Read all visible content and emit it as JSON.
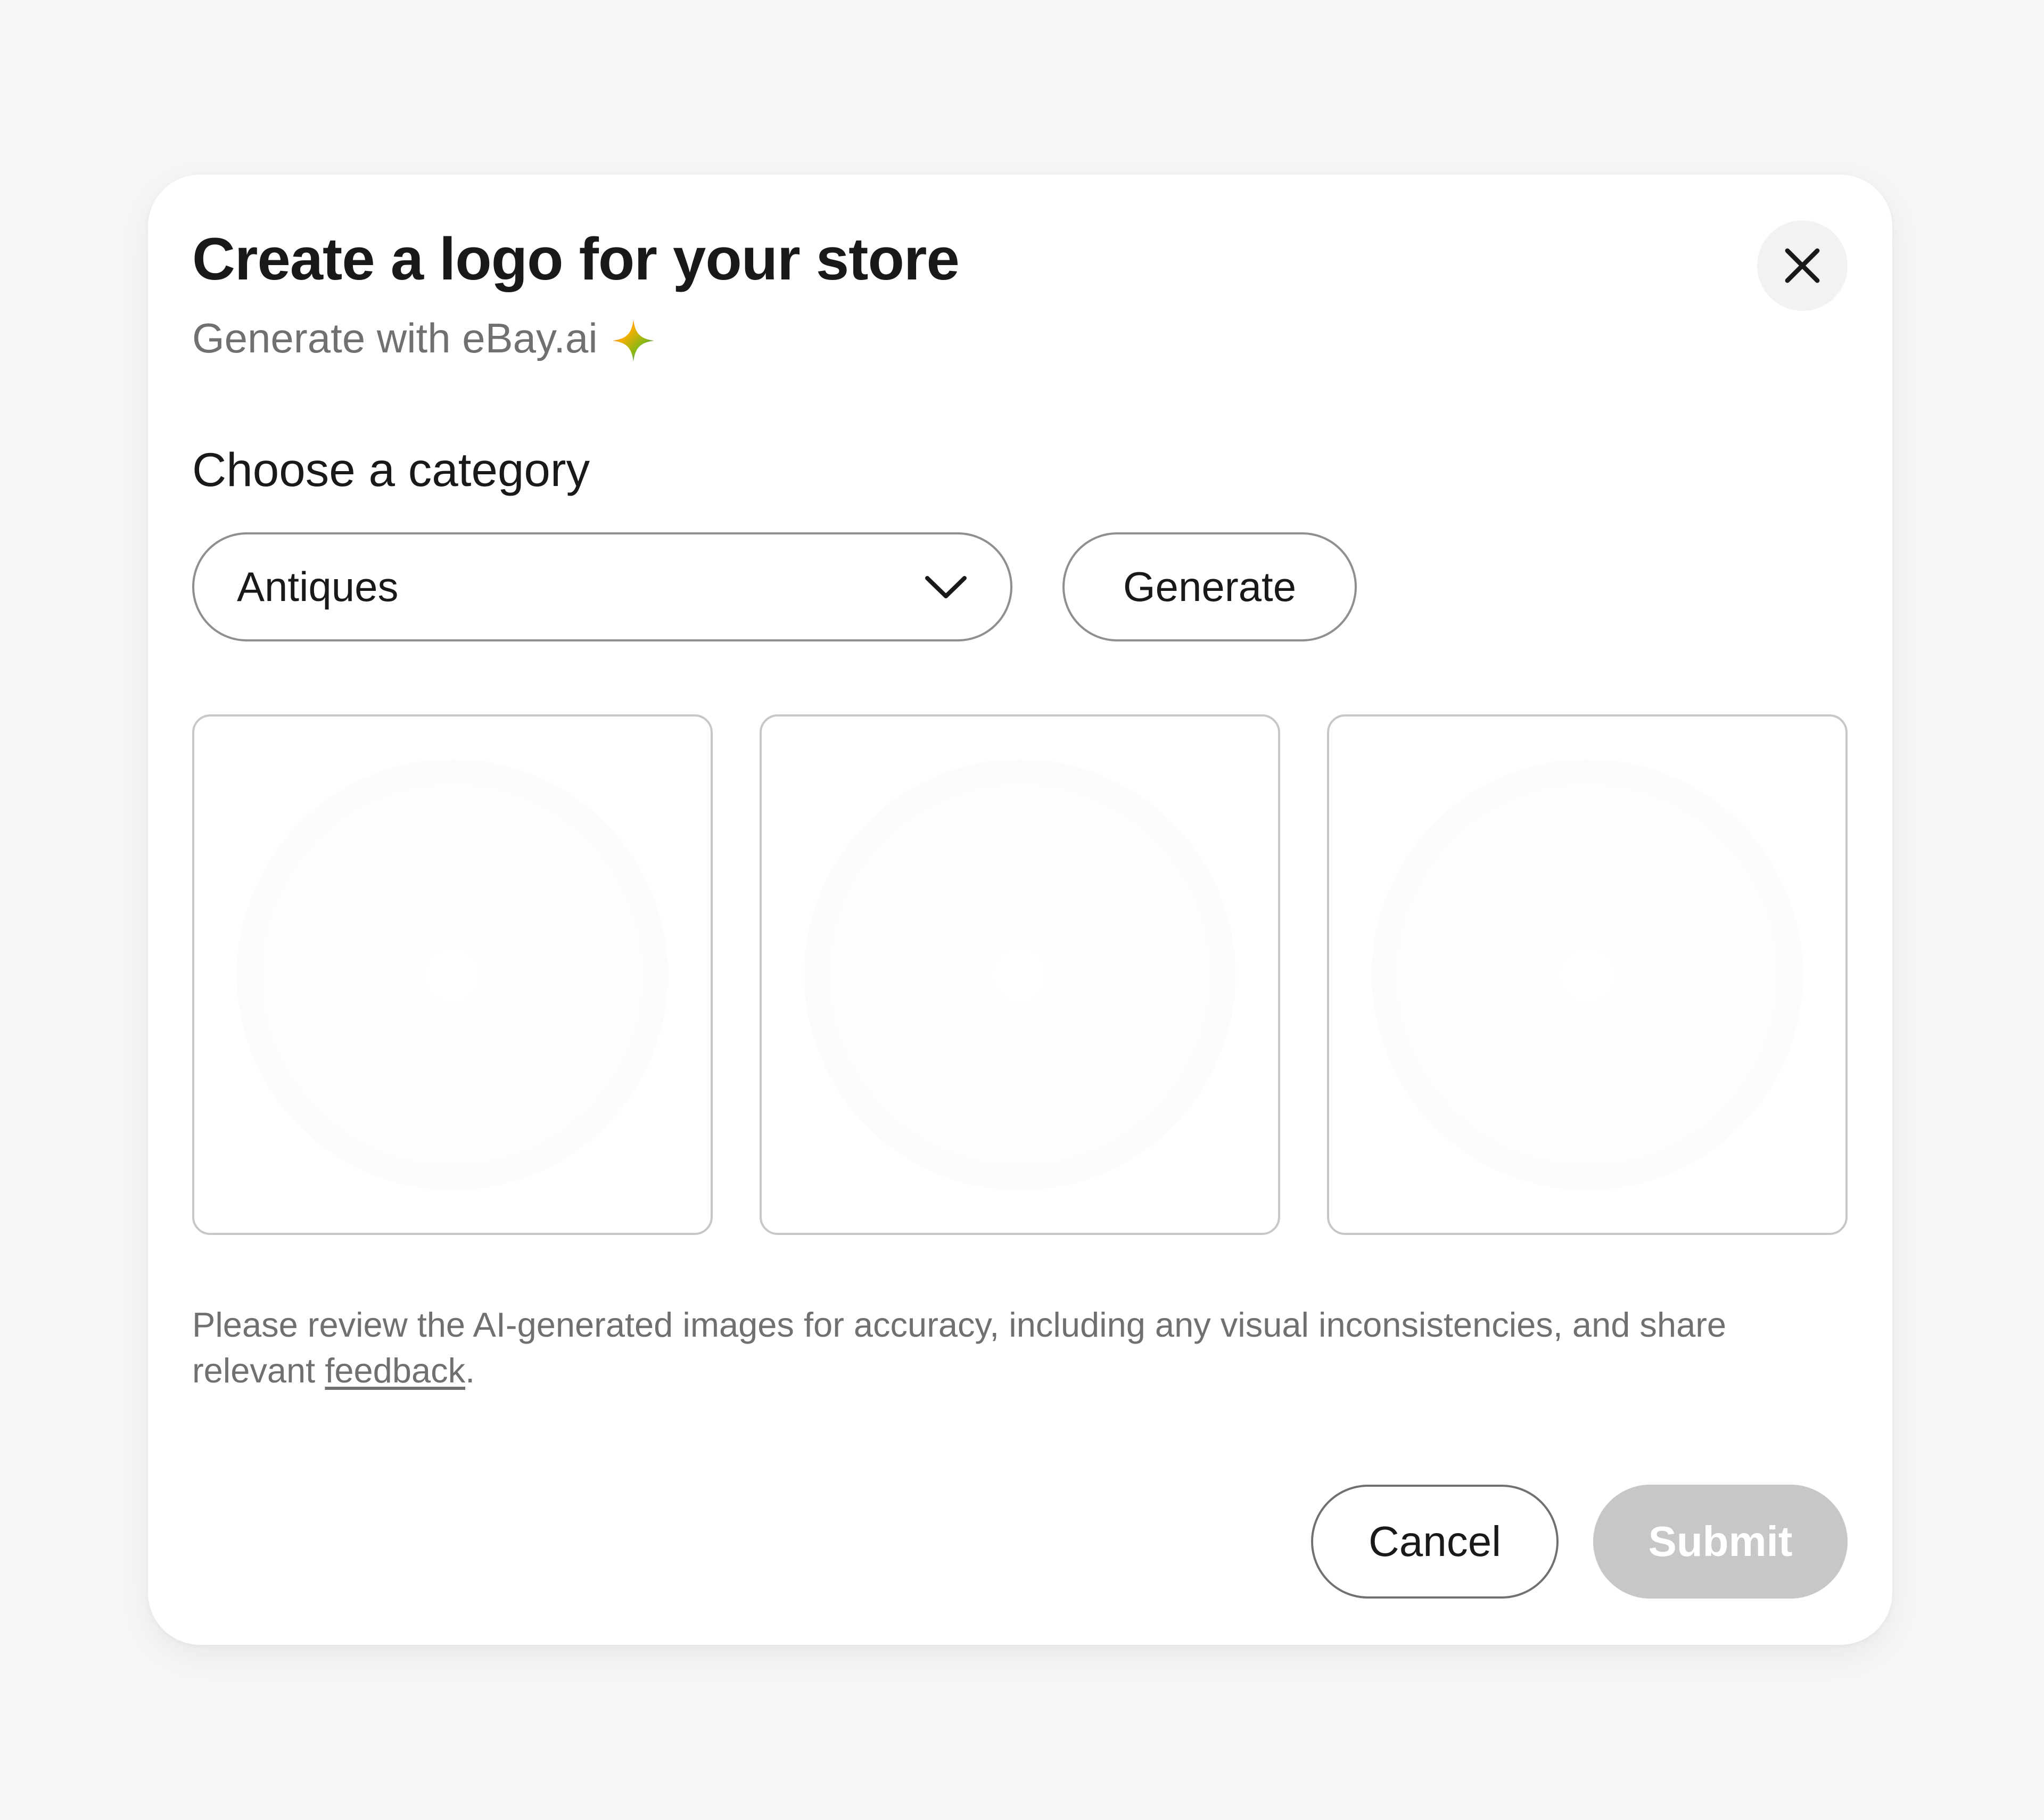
{
  "dialog": {
    "title": "Create a logo for your store",
    "subtitle": "Generate with eBay.ai",
    "subtitle_icon": "ai-sparkle-icon",
    "close_icon": "close-icon"
  },
  "category": {
    "label": "Choose a category",
    "selected": "Antiques",
    "dropdown_icon": "chevron-down-icon"
  },
  "actions": {
    "generate_label": "Generate",
    "cancel_label": "Cancel",
    "submit_label": "Submit",
    "submit_enabled": false
  },
  "logo_options": [
    {
      "state": "empty"
    },
    {
      "state": "empty"
    },
    {
      "state": "empty"
    }
  ],
  "disclaimer": {
    "text_before": "Please review the AI-generated images for accuracy, including any visual inconsistencies, and share relevant ",
    "link_text": "feedback",
    "text_after": "."
  },
  "colors": {
    "background": "#f6f6f6",
    "dialog_background": "#ffffff",
    "text_primary": "#191919",
    "text_secondary": "#707070",
    "border": "#8f8f8f",
    "disabled_button": "#c7c7c7",
    "sparkle_gradient": [
      "#3665f3",
      "#e53238",
      "#f5af02",
      "#86b817"
    ]
  }
}
